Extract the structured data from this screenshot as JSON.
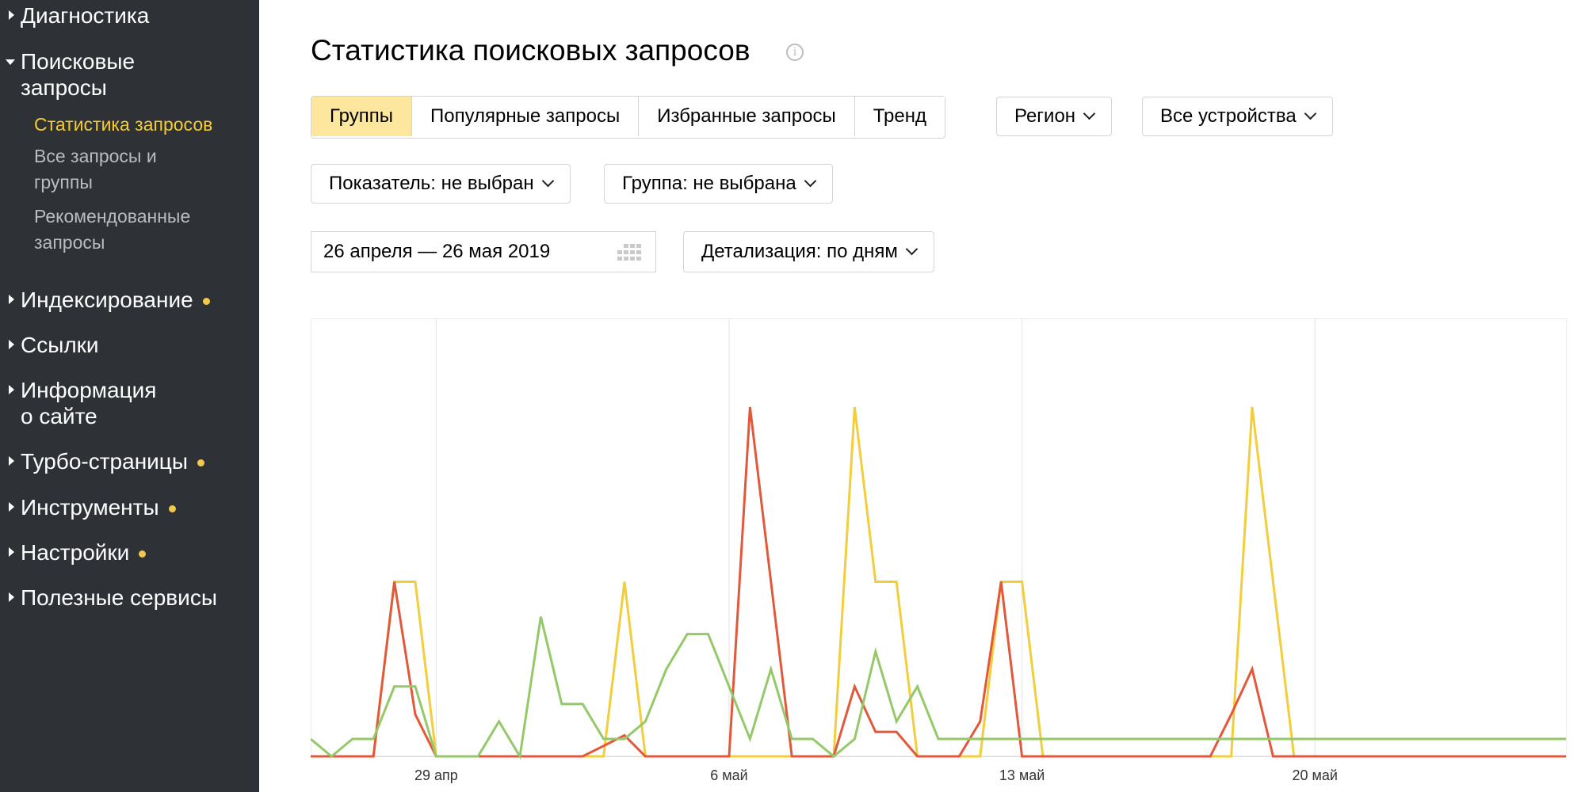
{
  "sidebar": {
    "items": [
      {
        "label": "Диагностика",
        "expanded": false,
        "dot": false
      },
      {
        "label": "Поисковые\nзапросы",
        "expanded": true,
        "dot": false
      },
      {
        "label": "Индексирование",
        "expanded": false,
        "dot": true
      },
      {
        "label": "Ссылки",
        "expanded": false,
        "dot": false
      },
      {
        "label": "Информация\nо сайте",
        "expanded": false,
        "dot": false
      },
      {
        "label": "Турбо-страницы",
        "expanded": false,
        "dot": true
      },
      {
        "label": "Инструменты",
        "expanded": false,
        "dot": true
      },
      {
        "label": "Настройки",
        "expanded": false,
        "dot": true
      },
      {
        "label": "Полезные сервисы",
        "expanded": false,
        "dot": false
      }
    ],
    "subitems": [
      {
        "label": "Статистика запросов",
        "active": true
      },
      {
        "label": "Все запросы и\nгруппы",
        "active": false
      },
      {
        "label": "Рекомендованные\nзапросы",
        "active": false
      }
    ]
  },
  "header": {
    "title": "Статистика поисковых запросов",
    "info_icon": "info-icon"
  },
  "tabs": [
    {
      "label": "Группы",
      "active": true
    },
    {
      "label": "Популярные запросы",
      "active": false
    },
    {
      "label": "Избранные запросы",
      "active": false
    },
    {
      "label": "Тренд",
      "active": false
    }
  ],
  "filters": {
    "region": "Регион",
    "devices": "Все устройства",
    "indicator": "Показатель: не выбран",
    "group": "Группа: не выбрана",
    "date_range": "26 апреля — 26 мая 2019",
    "detail": "Детализация: по дням"
  },
  "colors": {
    "sidebar_bg": "#2e3136",
    "accent": "#f5cc32",
    "active_tab": "#fde79f",
    "series_red": "#e2583b",
    "series_yellow": "#f2cd3c",
    "series_green": "#95c86a"
  },
  "chart_data": {
    "type": "line",
    "x_start": "26 апр",
    "x_tick_labels": [
      "29 апр",
      "6 май",
      "13 май",
      "20 май"
    ],
    "grid": "vertical",
    "y_axis_labels": "none",
    "ylim": [
      0,
      1
    ],
    "series": [
      {
        "color": "#f2cd3c",
        "values": [
          0,
          0,
          0,
          0,
          0.5,
          0.5,
          0,
          0,
          0,
          0,
          0,
          0,
          0,
          0,
          0,
          0.5,
          0,
          0,
          0,
          0,
          0,
          0,
          0,
          0,
          0,
          0,
          1,
          0.5,
          0.5,
          0,
          0,
          0,
          0,
          0.5,
          0.5,
          0,
          0,
          0,
          0,
          0,
          0,
          0,
          0,
          0,
          0,
          1,
          0.5,
          0,
          0,
          0,
          0,
          0,
          0,
          0,
          0,
          0,
          0,
          0,
          0,
          0,
          0
        ]
      },
      {
        "color": "#e2583b",
        "values": [
          0,
          0,
          0,
          0,
          0.5,
          0.12,
          0,
          0,
          0,
          0,
          0,
          0,
          0,
          0,
          0.03,
          0.06,
          0,
          0,
          0,
          0,
          0,
          1,
          0.5,
          0,
          0,
          0,
          0.2,
          0.07,
          0.07,
          0,
          0,
          0,
          0.1,
          0.5,
          0,
          0,
          0,
          0,
          0,
          0,
          0,
          0,
          0,
          0,
          0.12,
          0.25,
          0,
          0,
          0,
          0,
          0,
          0,
          0,
          0,
          0,
          0,
          0,
          0,
          0,
          0,
          0
        ]
      },
      {
        "color": "#95c86a",
        "values": [
          0.05,
          0,
          0.05,
          0.05,
          0.2,
          0.2,
          0,
          0,
          0,
          0.1,
          0,
          0.4,
          0.15,
          0.15,
          0.05,
          0.05,
          0.1,
          0.25,
          0.35,
          0.35,
          0.2,
          0.05,
          0.25,
          0.05,
          0.05,
          0,
          0.05,
          0.3,
          0.1,
          0.2,
          0.05,
          0.05,
          0.05,
          0.05,
          0.05,
          0.05,
          0.05,
          0.05,
          0.05,
          0.05,
          0.05,
          0.05,
          0.05,
          0.05,
          0.05,
          0.05,
          0.05,
          0.05,
          0.05,
          0.05,
          0.05,
          0.05,
          0.05,
          0.05,
          0.05,
          0.05,
          0.05,
          0.05,
          0.05,
          0.05,
          0.05
        ]
      }
    ]
  }
}
